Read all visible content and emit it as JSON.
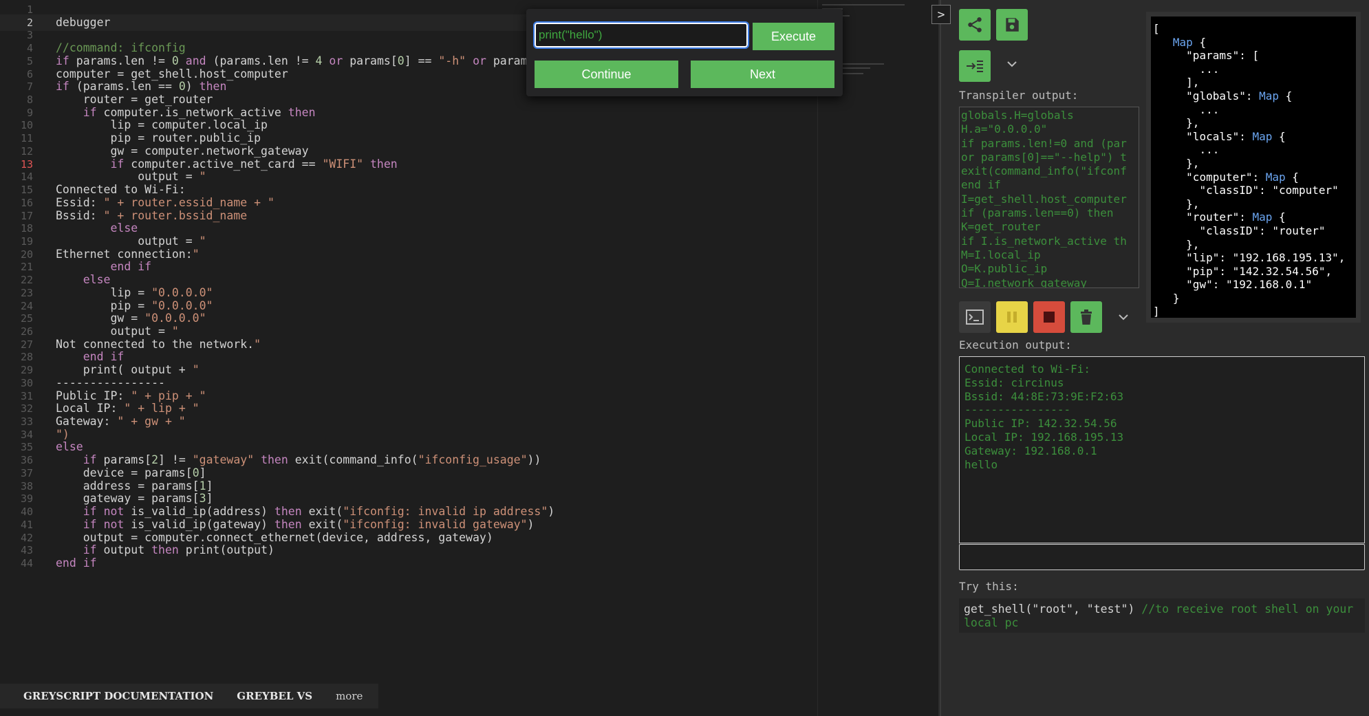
{
  "editor": {
    "lines": [
      {
        "n": "1",
        "t": ""
      },
      {
        "n": "2",
        "t": "debugger"
      },
      {
        "n": "3",
        "t": ""
      },
      {
        "n": "4",
        "t": "//command: ifconfig"
      },
      {
        "n": "5",
        "t": "if params.len != 0 and (params.len != 4 or params[0] == \"-h\" or params[0"
      },
      {
        "n": "6",
        "t": "computer = get_shell.host_computer"
      },
      {
        "n": "7",
        "t": "if (params.len == 0) then"
      },
      {
        "n": "8",
        "t": "    router = get_router"
      },
      {
        "n": "9",
        "t": "    if computer.is_network_active then"
      },
      {
        "n": "10",
        "t": "        lip = computer.local_ip"
      },
      {
        "n": "11",
        "t": "        pip = router.public_ip"
      },
      {
        "n": "12",
        "t": "        gw = computer.network_gateway"
      },
      {
        "n": "13",
        "t": "        if computer.active_net_card == \"WIFI\" then"
      },
      {
        "n": "14",
        "t": "            output = \""
      },
      {
        "n": "15",
        "t": "Connected to Wi-Fi:"
      },
      {
        "n": "16",
        "t": "Essid: \" + router.essid_name + \""
      },
      {
        "n": "17",
        "t": "Bssid: \" + router.bssid_name"
      },
      {
        "n": "18",
        "t": "        else"
      },
      {
        "n": "19",
        "t": "            output = \""
      },
      {
        "n": "20",
        "t": "Ethernet connection:\""
      },
      {
        "n": "21",
        "t": "        end if"
      },
      {
        "n": "22",
        "t": "    else"
      },
      {
        "n": "23",
        "t": "        lip = \"0.0.0.0\""
      },
      {
        "n": "24",
        "t": "        pip = \"0.0.0.0\""
      },
      {
        "n": "25",
        "t": "        gw = \"0.0.0.0\""
      },
      {
        "n": "26",
        "t": "        output = \""
      },
      {
        "n": "27",
        "t": "Not connected to the network.\""
      },
      {
        "n": "28",
        "t": "    end if"
      },
      {
        "n": "29",
        "t": "    print( output + \""
      },
      {
        "n": "30",
        "t": "----------------"
      },
      {
        "n": "31",
        "t": "Public IP: \" + pip + \""
      },
      {
        "n": "32",
        "t": "Local IP: \" + lip + \""
      },
      {
        "n": "33",
        "t": "Gateway: \" + gw + \""
      },
      {
        "n": "34",
        "t": "\")"
      },
      {
        "n": "35",
        "t": "else"
      },
      {
        "n": "36",
        "t": "    if params[2] != \"gateway\" then exit(command_info(\"ifconfig_usage\"))"
      },
      {
        "n": "37",
        "t": "    device = params[0]"
      },
      {
        "n": "38",
        "t": "    address = params[1]"
      },
      {
        "n": "39",
        "t": "    gateway = params[3]"
      },
      {
        "n": "40",
        "t": "    if not is_valid_ip(address) then exit(\"ifconfig: invalid ip address\")"
      },
      {
        "n": "41",
        "t": "    if not is_valid_ip(gateway) then exit(\"ifconfig: invalid gateway\")"
      },
      {
        "n": "42",
        "t": "    output = computer.connect_ethernet(device, address, gateway)"
      },
      {
        "n": "43",
        "t": "    if output then print(output)"
      },
      {
        "n": "44",
        "t": "end if"
      }
    ],
    "current_line": "2",
    "breakpoint_line": "13"
  },
  "debugger": {
    "input_value": "print(\"hello\")",
    "execute_label": "Execute",
    "continue_label": "Continue",
    "next_label": "Next"
  },
  "panel": {
    "toggle_glyph": ">",
    "transpiler_label": "Transpiler output:",
    "transpiler_output": "globals.H=globals\nH.a=\"0.0.0.0\"\nif params.len!=0 and (par\nor params[0]==\"--help\") t\nexit(command_info(\"ifconf\nend if\nI=get_shell.host_computer\nif (params.len==0) then\nK=get_router\nif I.is_network_active th\nM=I.local_ip\nO=K.public_ip\nQ=I.network_gateway",
    "execution_label": "Execution output:",
    "execution_output": "Connected to Wi-Fi:\nEssid: circinus\nBssid: 44:8E:73:9E:F2:63\n----------------\nPublic IP: 142.32.54.56\nLocal IP: 192.168.195.13\nGateway: 192.168.0.1\nhello",
    "try_label": "Try this:",
    "try_code": "get_shell(\"root\", \"test\")",
    "try_comment": " //to receive root shell on your local pc"
  },
  "variables": {
    "open": "[",
    "close": "]",
    "map_type": "Map",
    "params_key": "\"params\"",
    "globals_key": "\"globals\"",
    "locals_key": "\"locals\"",
    "computer_key": "\"computer\"",
    "router_key": "\"router\"",
    "classid_key": "\"classID\"",
    "computer_class": "\"computer\"",
    "router_class": "\"router\"",
    "lip_key": "\"lip\"",
    "lip_val": "\"192.168.195.13\"",
    "pip_key": "\"pip\"",
    "pip_val": "\"142.32.54.56\"",
    "gw_key": "\"gw\"",
    "gw_val": "\"192.168.0.1\"",
    "ellipsis": "..."
  },
  "bottom_links": {
    "docs": "GREYSCRIPT DOCUMENTATION",
    "greybel": "GREYBEL VS",
    "more": "more"
  },
  "colors": {
    "accent_green": "#5cb85c",
    "pause_yellow": "#e7d447",
    "stop_red": "#d64c3c",
    "output_green": "#3c8f3c"
  }
}
